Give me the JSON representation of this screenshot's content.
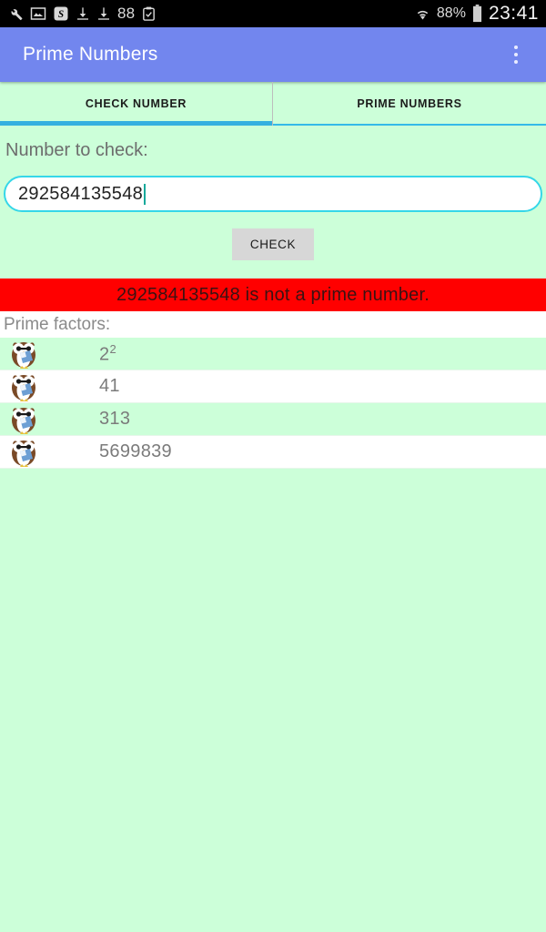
{
  "status_bar": {
    "left_icons": [
      "wrench-icon",
      "image-icon",
      "s-circle-icon",
      "download-icon",
      "download-icon",
      "clipboard-check-icon"
    ],
    "notification_count": "88",
    "wifi_icon": "wifi-icon",
    "battery_percent": "88%",
    "battery_icon": "battery-icon",
    "clock": "23:41"
  },
  "app_bar": {
    "title": "Prime Numbers",
    "overflow_icon": "more-vert-icon",
    "color": "#7286ee"
  },
  "tabs": [
    {
      "label": "CHECK NUMBER",
      "active": true
    },
    {
      "label": "PRIME NUMBERS",
      "active": false
    }
  ],
  "form": {
    "label": "Number to check:",
    "input_value": "292584135548",
    "input_placeholder": "",
    "button_label": "CHECK"
  },
  "result": {
    "text": "292584135548 is not a prime number.",
    "banner_color": "#ff0000"
  },
  "factors": {
    "label": "Prime factors:",
    "items": [
      {
        "base": "2",
        "exponent": "2",
        "icon": "owl-icon"
      },
      {
        "base": "41",
        "exponent": "",
        "icon": "owl-icon"
      },
      {
        "base": "313",
        "exponent": "",
        "icon": "owl-icon"
      },
      {
        "base": "5699839",
        "exponent": "",
        "icon": "owl-icon"
      }
    ]
  },
  "theme": {
    "background": "#ccffd9",
    "accent": "#35b0e0",
    "input_border": "#35d7e8"
  }
}
